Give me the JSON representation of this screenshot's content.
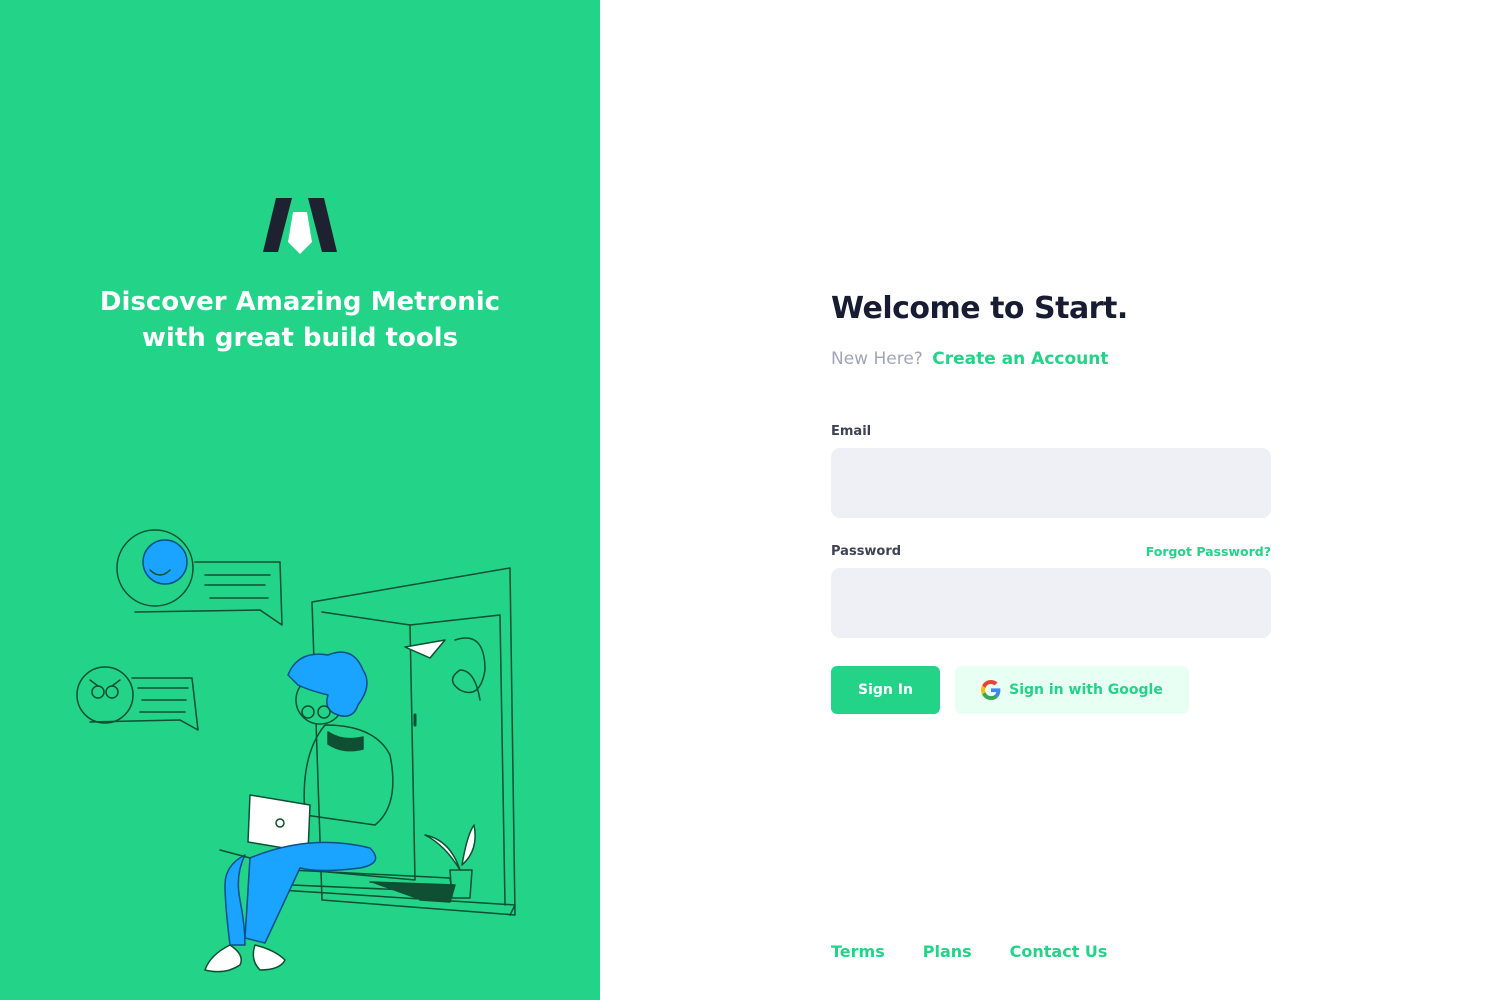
{
  "aside": {
    "title_line1": "Discover Amazing Metronic",
    "title_line2": "with great build tools",
    "logo_icon": "metronic-logo-icon",
    "illustration": "person-with-laptop-illustration",
    "background_color": "#22d388"
  },
  "form": {
    "title": "Welcome to Start.",
    "new_here": "New Here?",
    "create_account": "Create an Account",
    "email_label": "Email",
    "email_value": "",
    "password_label": "Password",
    "password_value": "",
    "forgot_password": "Forgot Password?",
    "sign_in": "Sign In",
    "google_sign_in": "Sign in with Google",
    "google_icon": "google-icon"
  },
  "footer": {
    "links": [
      "Terms",
      "Plans",
      "Contact Us"
    ]
  },
  "colors": {
    "accent": "#22d388",
    "heading": "#181c32",
    "muted": "#a1a5b7",
    "input_bg": "#eef0f5",
    "google_button_bg": "#e8fff3"
  }
}
